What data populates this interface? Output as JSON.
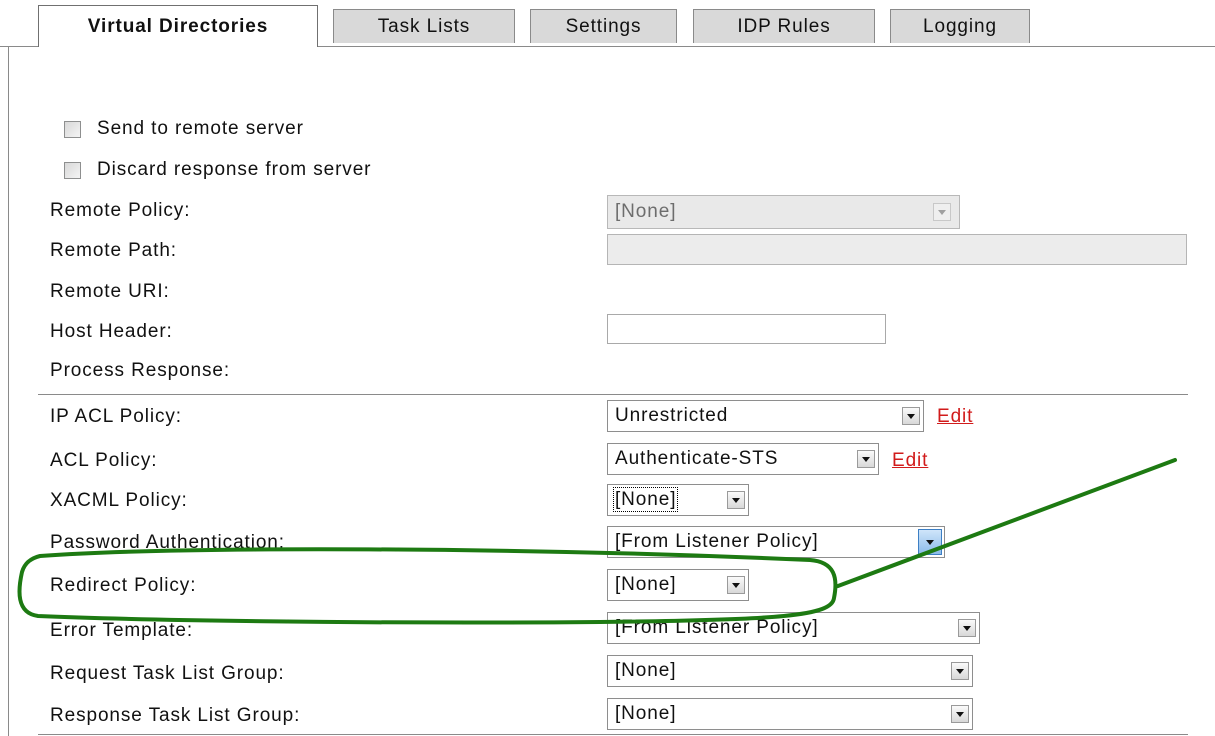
{
  "tabs": [
    {
      "label": "Virtual Directories",
      "active": true
    },
    {
      "label": "Task Lists",
      "active": false
    },
    {
      "label": "Settings",
      "active": false
    },
    {
      "label": "IDP Rules",
      "active": false
    },
    {
      "label": "Logging",
      "active": false
    }
  ],
  "remote": {
    "send_to_remote_label": "Send to remote server",
    "send_to_remote_checked": false,
    "discard_response_label": "Discard response from server",
    "discard_response_checked": false,
    "remote_policy_label": "Remote Policy:",
    "remote_policy_value": "[None]",
    "remote_path_label": "Remote Path:",
    "remote_path_value": "",
    "remote_uri_label": "Remote URI:",
    "host_header_label": "Host Header:",
    "host_header_value": "",
    "process_response_label": "Process Response:"
  },
  "policies": {
    "ip_acl_label": "IP ACL Policy:",
    "ip_acl_value": "Unrestricted",
    "acl_label": "ACL Policy:",
    "acl_value": "Authenticate-STS",
    "xacml_label": "XACML Policy:",
    "xacml_value": "[None]",
    "password_auth_label": "Password Authentication:",
    "password_auth_value": "[From Listener Policy]",
    "redirect_label": "Redirect Policy:",
    "redirect_value": "[None]",
    "error_template_label": "Error Template:",
    "error_template_value": "[From Listener Policy]",
    "request_task_label": "Request Task List Group:",
    "request_task_value": "[None]",
    "response_task_label": "Response Task List Group:",
    "response_task_value": "[None]",
    "edit_label": "Edit"
  },
  "annotation": {
    "color": "#1d7a12",
    "highlighted_row": "Redirect Policy"
  }
}
